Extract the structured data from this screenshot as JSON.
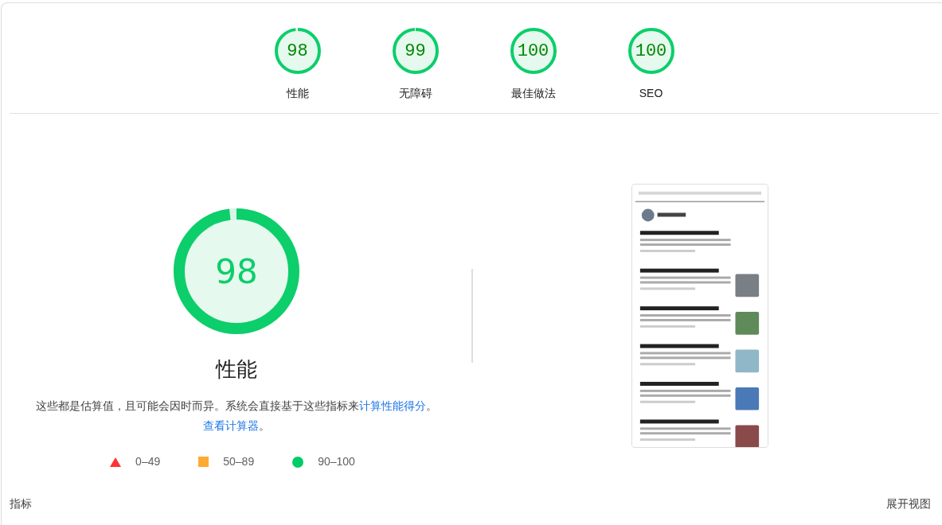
{
  "summary_gauges": [
    {
      "score": "98",
      "label": "性能",
      "level": 0.98
    },
    {
      "score": "99",
      "label": "无障碍",
      "level": 0.99
    },
    {
      "score": "100",
      "label": "最佳做法",
      "level": 1
    },
    {
      "score": "100",
      "label": "SEO",
      "level": 1
    }
  ],
  "performance": {
    "score": "98",
    "level": 0.98,
    "title": "性能",
    "description": [
      {
        "kind": "text",
        "text": "这些都是估算值，且可能会因时而异。系统会直接基于这些指标来"
      },
      {
        "kind": "link",
        "text": "计算性能得分"
      },
      {
        "kind": "text",
        "text": "。 "
      },
      {
        "kind": "link",
        "text": "查看计算器"
      },
      {
        "kind": "text",
        "text": "。"
      }
    ],
    "legend": [
      {
        "kind": "triangle",
        "color": "#ff3333",
        "label": "0–49"
      },
      {
        "kind": "square",
        "color": "#ffaa33",
        "label": "50–89"
      },
      {
        "kind": "circle",
        "color": "#00cc66",
        "label": "90–100"
      }
    ]
  },
  "metrics_header": {
    "title": "指标",
    "toggle": "展开视图"
  }
}
